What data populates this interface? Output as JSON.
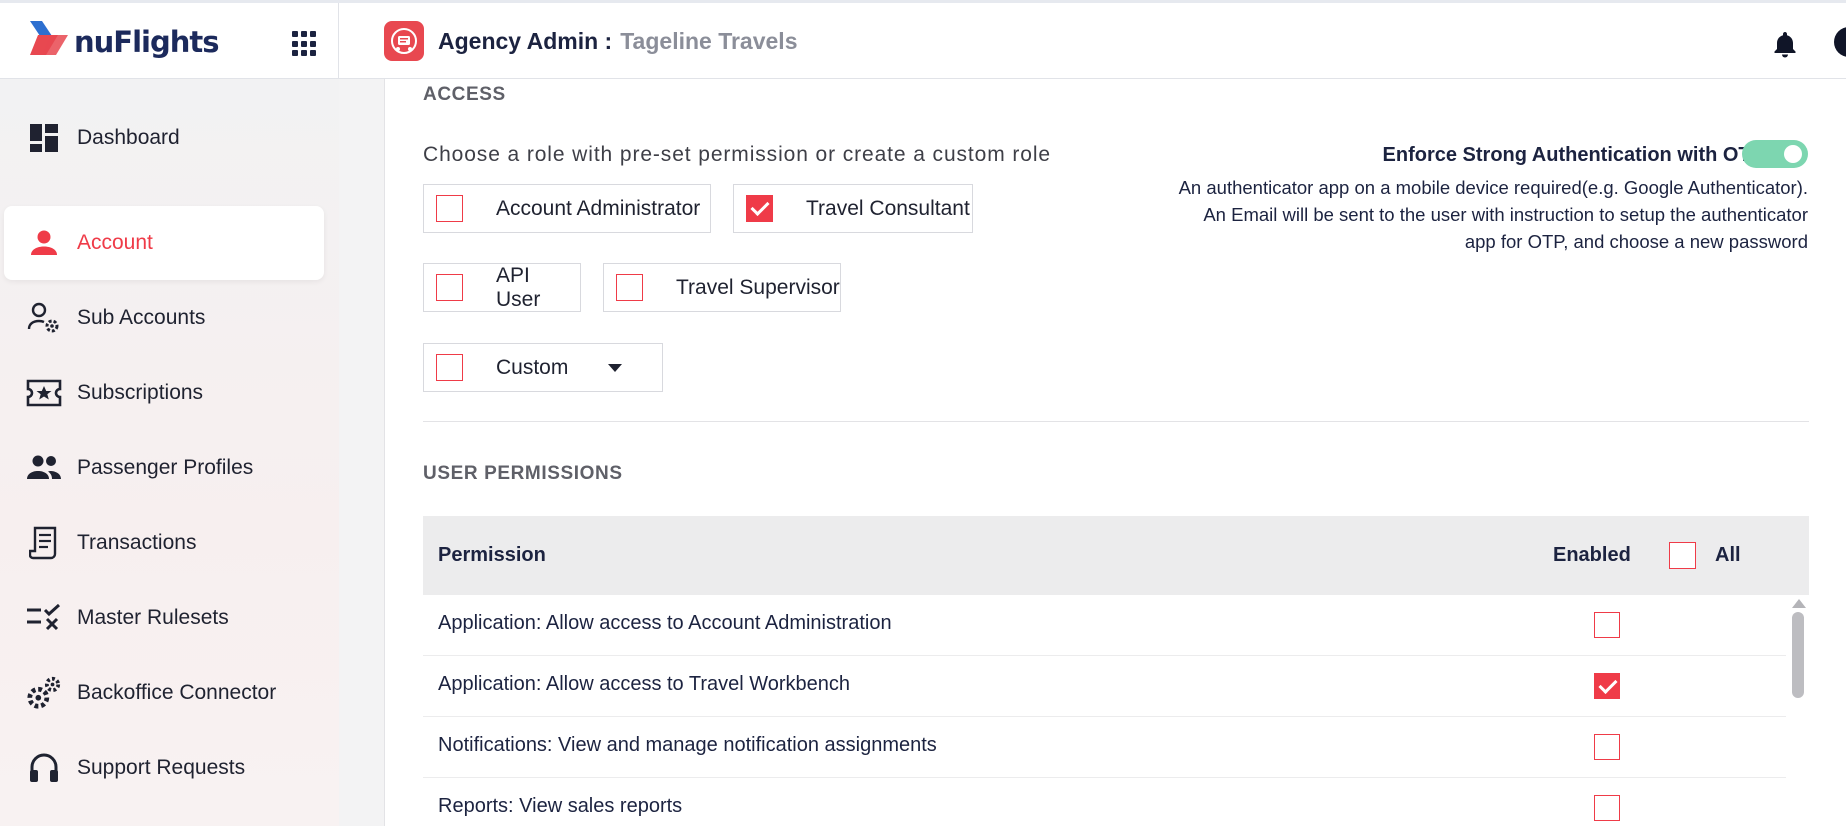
{
  "brand": {
    "name": "nuFlights",
    "logo_icon": "nuflights-logo"
  },
  "header": {
    "title": "Agency Admin :",
    "agency_name": "Tageline Travels",
    "agency_icon": "agency-badge-icon",
    "apps_icon": "apps-grid-icon",
    "bell_icon": "bell-icon",
    "user_icon": "user-avatar-icon"
  },
  "sidebar": {
    "items": [
      {
        "label": "Dashboard",
        "icon": "dashboard-icon",
        "active": false
      },
      {
        "label": "Account",
        "icon": "person-icon",
        "active": true
      },
      {
        "label": "Sub Accounts",
        "icon": "user-settings-icon",
        "active": false
      },
      {
        "label": "Subscriptions",
        "icon": "ticket-star-icon",
        "active": false
      },
      {
        "label": "Passenger Profiles",
        "icon": "people-icon",
        "active": false
      },
      {
        "label": "Transactions",
        "icon": "receipt-icon",
        "active": false
      },
      {
        "label": "Master Rulesets",
        "icon": "rules-check-icon",
        "active": false
      },
      {
        "label": "Backoffice Connector",
        "icon": "gears-icon",
        "active": false
      },
      {
        "label": "Support Requests",
        "icon": "headset-icon",
        "active": false
      }
    ]
  },
  "access": {
    "title": "ACCESS",
    "hint": "Choose a role with pre-set permission or create a custom role",
    "roles": [
      {
        "label": "Account Administrator",
        "checked": false
      },
      {
        "label": "Travel Consultant",
        "checked": true
      },
      {
        "label": "API User",
        "checked": false
      },
      {
        "label": "Travel Supervisor",
        "checked": false
      },
      {
        "label": "Custom",
        "checked": false
      }
    ],
    "otp": {
      "title": "Enforce Strong Authentication with OTP",
      "enabled": true,
      "line1": "An authenticator app on a mobile device required(e.g. Google Authenticator).",
      "line2": "An Email will be sent to the user with instruction to setup the authenticator",
      "line3": "app for OTP, and choose a new password"
    }
  },
  "permissions": {
    "title": "USER PERMISSIONS",
    "col_permission": "Permission",
    "col_enabled": "Enabled",
    "col_all": "All",
    "all_checked": false,
    "rows": [
      {
        "label": "Application: Allow access to Account Administration",
        "enabled": false
      },
      {
        "label": "Application: Allow access to Travel Workbench",
        "enabled": true
      },
      {
        "label": "Notifications: View and manage notification assignments",
        "enabled": false
      },
      {
        "label": "Reports: View sales reports",
        "enabled": false
      }
    ]
  },
  "colors": {
    "accent": "#ef3b48",
    "toggle_on": "#7dd6b0",
    "navy": "#1c2340"
  }
}
